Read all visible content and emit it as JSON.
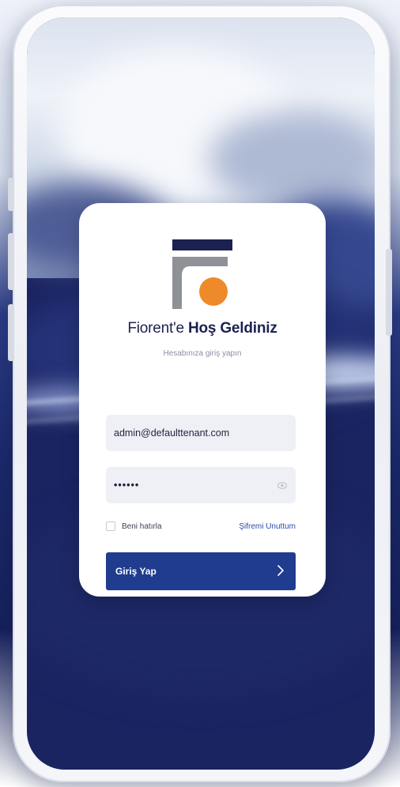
{
  "colors": {
    "brand_navy": "#1b2250",
    "brand_gray": "#8e9196",
    "brand_orange": "#ee8a2a",
    "button_blue": "#1f3c8f",
    "link_blue": "#2a4aa8"
  },
  "login": {
    "title_prefix": "Fiorent'e ",
    "title_bold": "Hoş Geldiniz",
    "subtitle": "Hesabınıza giriş yapın",
    "email_value": "admin@defaulttenant.com",
    "password_value": "••••••",
    "password_toggle_icon": "eye-icon",
    "remember_label": "Beni hatırla",
    "forgot_label": "Şifremi Unuttum",
    "submit_label": "Giriş Yap",
    "submit_icon": "chevron-right-icon"
  }
}
